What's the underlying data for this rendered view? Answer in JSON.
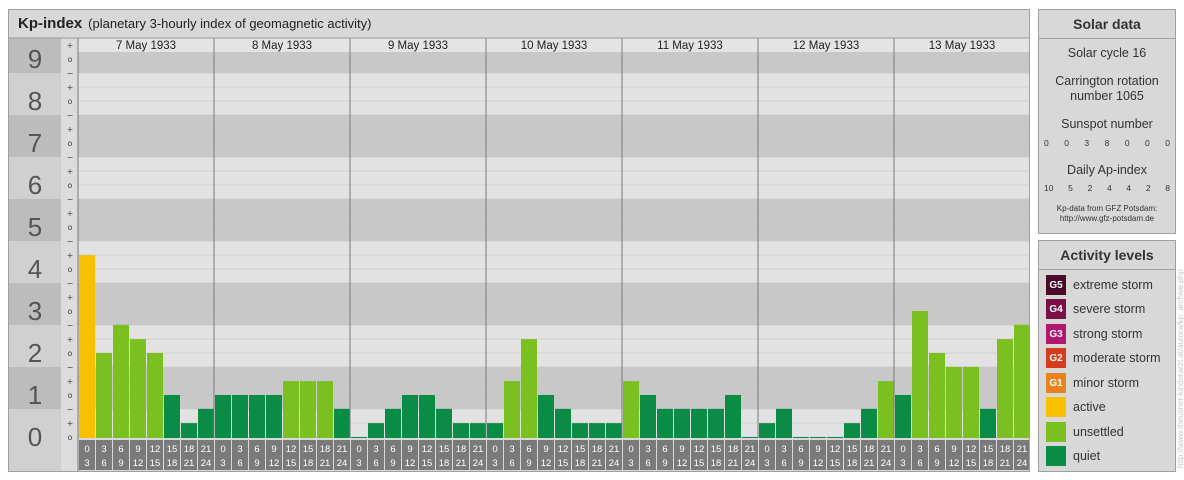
{
  "header": {
    "title": "Kp-index",
    "subtitle": "(planetary 3-hourly index of geomagnetic activity)"
  },
  "solar": {
    "title": "Solar data",
    "cycle": "Solar cycle 16",
    "carrington_line1": "Carrington rotation",
    "carrington_line2": "number 1065",
    "sunspot_label": "Sunspot number",
    "sunspot_values": [
      "0",
      "0",
      "3",
      "8",
      "0",
      "0",
      "0"
    ],
    "ap_label": "Daily Ap-index",
    "ap_values": [
      "10",
      "5",
      "2",
      "4",
      "4",
      "2",
      "8"
    ],
    "note_line1": "Kp-data from GFZ Potsdam:",
    "note_line2": "http://www.gfz-potsdam.de"
  },
  "activity": {
    "title": "Activity levels",
    "levels": [
      {
        "code": "G5",
        "label": "extreme storm",
        "color": "#4a0a2a"
      },
      {
        "code": "G4",
        "label": "severe storm",
        "color": "#7a1048"
      },
      {
        "code": "G3",
        "label": "strong storm",
        "color": "#b01870"
      },
      {
        "code": "G2",
        "label": "moderate storm",
        "color": "#d83a1c"
      },
      {
        "code": "G1",
        "label": "minor storm",
        "color": "#e8821c"
      },
      {
        "code": "",
        "label": "active",
        "color": "#f8c000"
      },
      {
        "code": "",
        "label": "unsettled",
        "color": "#7ac020"
      },
      {
        "code": "",
        "label": "quiet",
        "color": "#0a8c46"
      }
    ]
  },
  "watermark": "http://www.theusner-kinderarzt.at/aurora/kp_archive.php",
  "chart_data": {
    "type": "bar",
    "y_labels": [
      "0",
      "1",
      "2",
      "3",
      "4",
      "5",
      "6",
      "7",
      "8",
      "9"
    ],
    "subdivision_labels": [
      "+",
      "o",
      "−"
    ],
    "ylim": [
      0,
      9.33
    ],
    "days": [
      "7 May 1933",
      "8 May 1933",
      "9 May 1933",
      "10 May 1933",
      "11 May 1933",
      "12 May 1933",
      "13 May 1933"
    ],
    "interval_start": [
      "0",
      "3",
      "6",
      "9",
      "12",
      "15",
      "18",
      "21"
    ],
    "interval_end": [
      "3",
      "6",
      "9",
      "12",
      "15",
      "18",
      "21",
      "24"
    ],
    "values": [
      [
        4.33,
        2.0,
        2.67,
        2.33,
        2.0,
        1.0,
        0.33,
        0.67
      ],
      [
        1.0,
        1.0,
        1.0,
        1.0,
        1.33,
        1.33,
        1.33,
        0.67
      ],
      [
        0.0,
        0.33,
        0.67,
        1.0,
        1.0,
        0.67,
        0.33,
        0.33
      ],
      [
        0.33,
        1.33,
        2.33,
        1.0,
        0.67,
        0.33,
        0.33,
        0.33
      ],
      [
        1.33,
        1.0,
        0.67,
        0.67,
        0.67,
        0.67,
        1.0,
        0.0
      ],
      [
        0.33,
        0.67,
        0.0,
        0.0,
        0.0,
        0.33,
        0.67,
        1.33
      ],
      [
        1.0,
        3.0,
        2.0,
        1.67,
        1.67,
        0.67,
        2.33,
        2.67
      ]
    ],
    "thresholds": {
      "active": 4.0,
      "unsettled": 1.33
    },
    "colors": {
      "quiet": "#0a8c46",
      "unsettled": "#7ac020",
      "active": "#f8c000"
    }
  }
}
